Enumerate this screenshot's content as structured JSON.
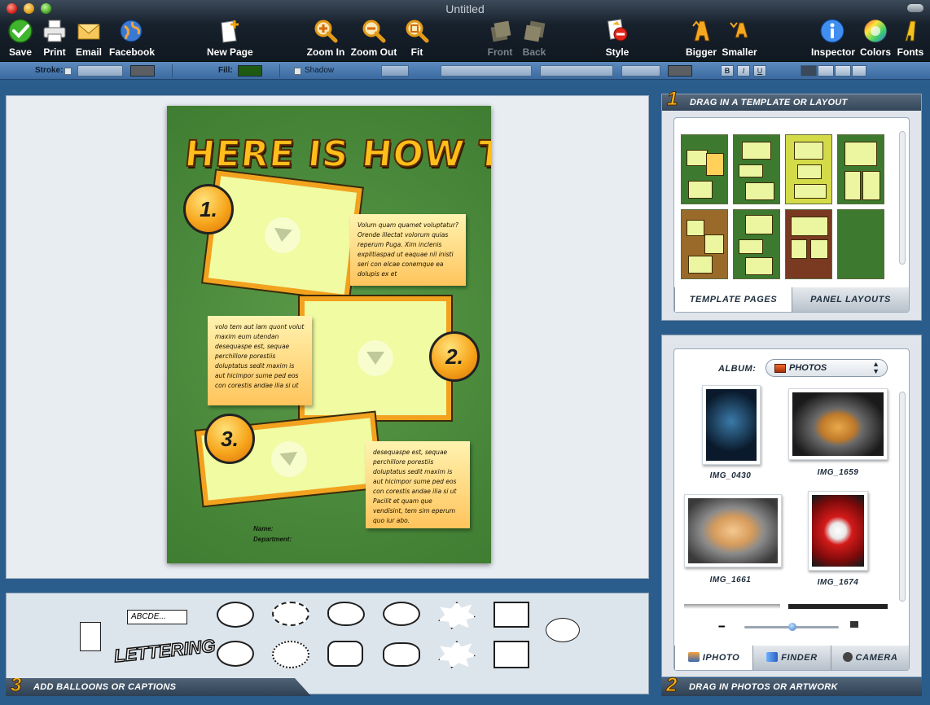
{
  "window": {
    "title": "Untitled"
  },
  "toolbar": {
    "save": "Save",
    "print": "Print",
    "email": "Email",
    "facebook": "Facebook",
    "new_page": "New Page",
    "zoom_in": "Zoom In",
    "zoom_out": "Zoom Out",
    "fit": "Fit",
    "front": "Front",
    "back": "Back",
    "style": "Style",
    "bigger": "Bigger",
    "smaller": "Smaller",
    "inspector": "Inspector",
    "colors": "Colors",
    "fonts": "Fonts"
  },
  "formatbar": {
    "stroke_label": "Stroke:",
    "fill_label": "Fill:",
    "shadow_label": "Shadow",
    "bold": "B",
    "italic": "I",
    "underline": "U",
    "fill_color": "#1f5a12",
    "stroke_color": "#5b5f63"
  },
  "page": {
    "headline": "HERE IS HOW TO...",
    "step1": "1.",
    "step2": "2.",
    "step3": "3.",
    "note1": "Volum quam quamet voluptatur? Orende illectat volorum quias reperum Puga. Xim inclenis explitiaspad ut eaquae nil inisti seri con elcae conemque ea dolupis ex et",
    "note2": "volo tem aut lam quont volut maxim eum utendan desequaspe est, sequae perchillore porestiis doluptatus sedit maxim is aut hicimpor sume ped eos con corestis andae ilia si ut",
    "note3": "desequaspe est, sequae perchillore porestiis doluptatus sedit maxim is aut hicimpor sume ped eos con corestis andae ilia si ut Pacilit et quam que vendisint, tem sim eperum quo iur abo.",
    "name_label": "Name:",
    "department_label": "Department:"
  },
  "templates_panel": {
    "number": "1",
    "header": "DRAG IN A TEMPLATE OR LAYOUT",
    "tab_templates": "TEMPLATE PAGES",
    "tab_layouts": "PANEL LAYOUTS"
  },
  "photos_panel": {
    "album_label": "ALBUM:",
    "album_value": "PHOTOS",
    "photos": [
      {
        "name": "IMG_0430"
      },
      {
        "name": "IMG_1659"
      },
      {
        "name": "IMG_1661"
      },
      {
        "name": "IMG_1674"
      }
    ],
    "tab_iphoto": "IPHOTO",
    "tab_finder": "FINDER",
    "tab_camera": "CAMERA",
    "footer_number": "2",
    "footer": "DRAG IN PHOTOS OR ARTWORK"
  },
  "balloons_panel": {
    "number": "3",
    "footer": "ADD BALLOONS OR CAPTIONS",
    "caption_sample": "ABCDE...",
    "lettering_sample": "LETTERING"
  }
}
